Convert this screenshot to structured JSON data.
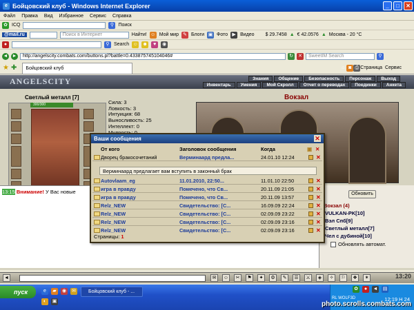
{
  "window": {
    "title": "Бойцовский клуб - Windows Internet Explorer"
  },
  "menu": [
    "Файл",
    "Правка",
    "Вид",
    "Избранное",
    "Сервис",
    "Справка"
  ],
  "toolbar1": {
    "icq": "ICQ",
    "search_label": "Поиск"
  },
  "toolbar2": {
    "mailru": "@mail.ru",
    "search_placeholder": "Поиск в Интернет",
    "find": "Найти!",
    "mymir": "Мой мир",
    "blogs": "Блоги",
    "photo": "Фото",
    "video": "Видео",
    "usd": "$ 29.7458",
    "eur": "€ 42.0576",
    "weather": "Москва - 20 °C"
  },
  "toolbar3": {
    "search": "Search"
  },
  "address": {
    "url": "http://angelscity.combats.com/buttons.pl?battle=0.433875745104046#",
    "search_placeholder": "SweetIM Search"
  },
  "tab": {
    "label": "Бойцовский клуб",
    "page": "Страница",
    "service": "Сервис"
  },
  "game": {
    "logo": "ANGELSCITY",
    "nav_top": [
      "Знания",
      "Общение",
      "Безопасность",
      "Персонаж",
      "Выход"
    ],
    "nav_bottom": [
      "Инвентарь",
      "Умения",
      "Мой Скролл",
      "Отчет о переводах",
      "Поединки",
      "Анкета"
    ],
    "char_name": "Светлый металл [7]",
    "hp": "300/300",
    "stats": [
      "Сила: 3",
      "Ловкость: 3",
      "Интуиция: 68",
      "Выносливость: 25",
      "Интеллект: 0",
      "Мудрость: 0"
    ],
    "location": "Вокзал",
    "chat_time": "13:15",
    "chat_warn": "Внимание!",
    "chat_text": "У Вас новые",
    "refresh": "Обновить",
    "occupants_title": "Вокзал (4)",
    "users": [
      "VULKAN-PK[10]",
      "Вэл Спб[9]",
      "Светлый металл[7]",
      "Чел с дубиной[10]"
    ],
    "autorefresh": "Обновлять автомат.",
    "clock": "13:20"
  },
  "dialog": {
    "title": "Ваши сообщения",
    "col_from": "От кого",
    "col_subject": "Заголовок сообщения",
    "col_when": "Когда",
    "messages": [
      {
        "from": "Дворец бракосочетаний",
        "subject": "Верминаард предла...",
        "when": "24.01.10 12:24"
      },
      {
        "from": "Autovlaam_eg",
        "subject": "11.01.2010, 22:50...",
        "when": "11.01.10 22:50"
      },
      {
        "from": "игра в правду",
        "subject": "Помечено, что Св...",
        "when": "20.11.09 21:05"
      },
      {
        "from": "игра в правду",
        "subject": "Помечено, что Св...",
        "when": "20.11.09 13:57"
      },
      {
        "from": "Relz_NEW",
        "subject": "Свидетельство: [С...",
        "when": "16.09.09 22:24"
      },
      {
        "from": "Relz_NEW",
        "subject": "Свидетельство: [С...",
        "when": "02.09.09 23:22"
      },
      {
        "from": "Relz_NEW",
        "subject": "Свидетельство: [С...",
        "when": "02.09.09 23:16"
      },
      {
        "from": "Relz_NEW",
        "subject": "Свидетельство: [С...",
        "when": "02.09.09 23:16"
      }
    ],
    "expanded": "Верминаард предлагает вам вступить в законный брак",
    "pages_label": "Страницы:",
    "page_num": "1"
  },
  "taskbar": {
    "start": "пуск",
    "item": "Бойцовский клуб - ...",
    "time": "12:19 Н 24",
    "tray_text": "RL WOLF3D"
  },
  "watermark": "photo.scrolls.combats.com"
}
